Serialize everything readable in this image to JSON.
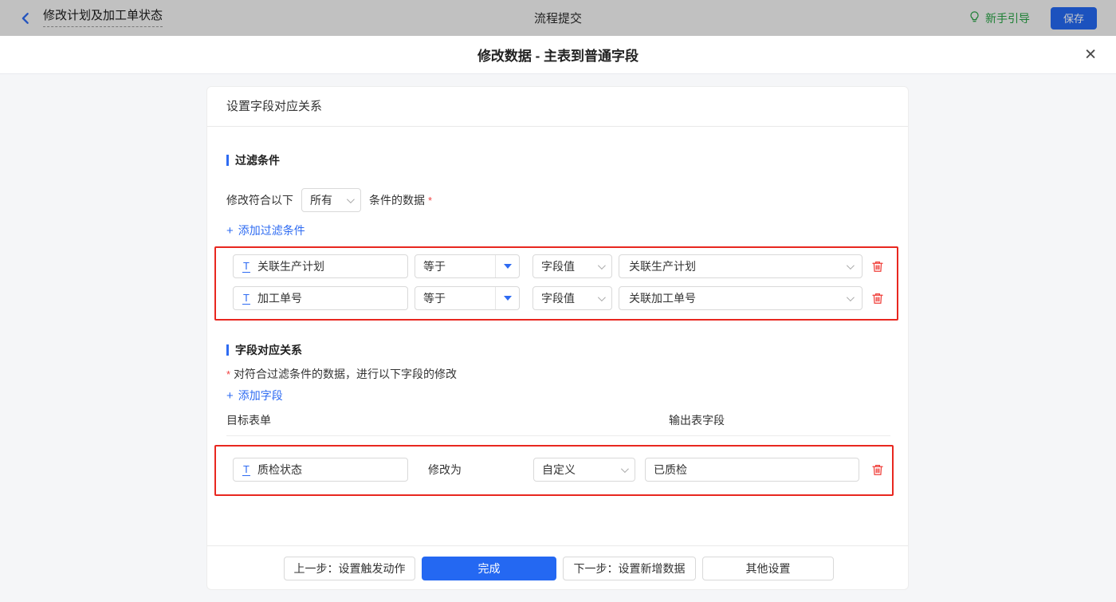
{
  "topbar": {
    "back_title": "修改计划及加工单状态",
    "center_title": "流程提交",
    "guide_label": "新手引导",
    "save_label": "保存"
  },
  "dialog": {
    "title": "修改数据 - 主表到普通字段"
  },
  "icons": {
    "close": "✕",
    "plus": "+",
    "text_field": "T"
  },
  "card": {
    "header": "设置字段对应关系",
    "filter_section": {
      "title": "过滤条件",
      "prefix": "修改符合以下",
      "match_select": "所有",
      "suffix": "条件的数据",
      "required_mark": "*",
      "add_label": "添加过滤条件",
      "rows": [
        {
          "field": "关联生产计划",
          "operator": "等于",
          "value_type": "字段值",
          "value": "关联生产计划"
        },
        {
          "field": "加工单号",
          "operator": "等于",
          "value_type": "字段值",
          "value": "关联加工单号"
        }
      ]
    },
    "mapping_section": {
      "title": "字段对应关系",
      "required_mark": "*",
      "description": "对符合过滤条件的数据，进行以下字段的修改",
      "add_label": "添加字段",
      "columns": {
        "target": "目标表单",
        "output": "输出表字段"
      },
      "rows": [
        {
          "field": "质检状态",
          "action": "修改为",
          "mode": "自定义",
          "value": "已质检"
        }
      ]
    },
    "footer": {
      "prev_label": "上一步：设置触发动作",
      "done_label": "完成",
      "next_label": "下一步：设置新增数据",
      "other_label": "其他设置"
    }
  },
  "colors": {
    "accent_blue": "#2468f2",
    "link_blue": "#2e6bf2",
    "danger_red": "#f03e3e",
    "annotation_red": "#e8271f",
    "success_green": "#27a344",
    "body_bg": "#f5f6f8"
  }
}
